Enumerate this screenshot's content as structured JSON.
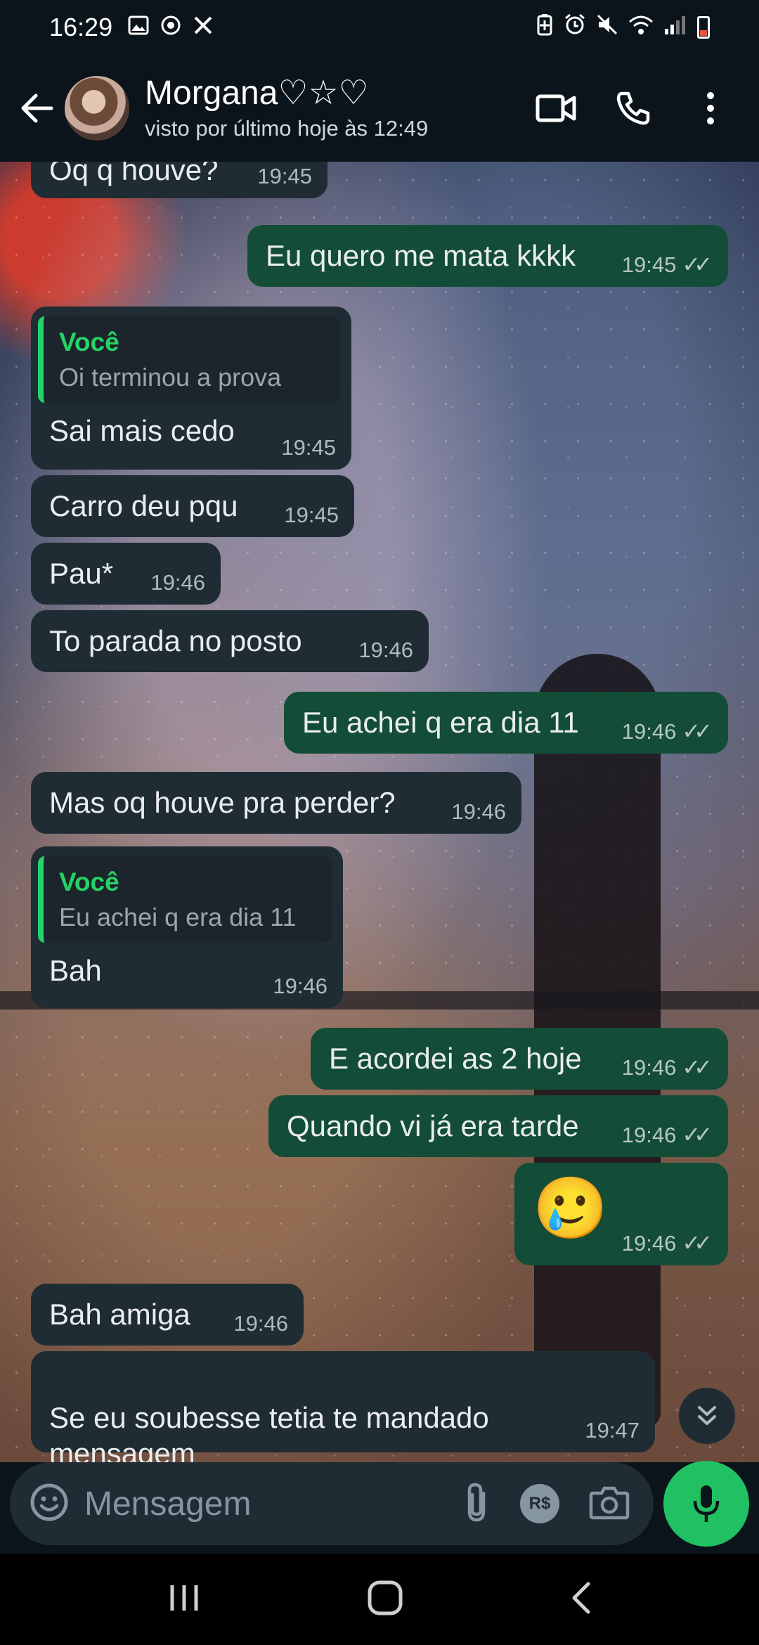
{
  "status_bar": {
    "time": "16:29",
    "left_icons": [
      "gallery-icon",
      "sync-icon",
      "x-icon"
    ],
    "right_icons": [
      "battery-saver-icon",
      "alarm-icon",
      "mute-icon",
      "wifi-icon",
      "signal-icon",
      "battery-icon"
    ]
  },
  "header": {
    "contact_name": "Morgana♡☆♡",
    "last_seen": "visto por último hoje às 12:49"
  },
  "messages": [
    {
      "dir": "in",
      "text": "Oq q houve?",
      "time": "19:45"
    },
    {
      "dir": "out",
      "text": "Eu quero me mata kkkk",
      "time": "19:45"
    },
    {
      "dir": "in",
      "quote_author": "Você",
      "quote_text": "Oi terminou a prova",
      "text": "Sai mais cedo",
      "time": "19:45"
    },
    {
      "dir": "in",
      "text": "Carro deu pqu",
      "time": "19:45"
    },
    {
      "dir": "in",
      "text": "Pau*",
      "time": "19:46"
    },
    {
      "dir": "in",
      "text": "To parada no posto",
      "time": "19:46"
    },
    {
      "dir": "out",
      "text": "Eu achei q era dia 11",
      "time": "19:46"
    },
    {
      "dir": "in",
      "text": "Mas oq houve pra perder?",
      "time": "19:46"
    },
    {
      "dir": "in",
      "quote_author": "Você",
      "quote_text": "Eu achei q era dia 11",
      "text": "Bah",
      "time": "19:46"
    },
    {
      "dir": "out",
      "text": "E acordei as 2 hoje",
      "time": "19:46"
    },
    {
      "dir": "out",
      "text": "Quando vi já era tarde",
      "time": "19:46"
    },
    {
      "dir": "out",
      "text": "🥲",
      "time": "19:46"
    },
    {
      "dir": "in",
      "text": "Bah amiga",
      "time": "19:46"
    },
    {
      "dir": "in",
      "text": "Se eu soubesse tetia te mandado\nmensagem",
      "time": "19:47"
    }
  ],
  "input": {
    "placeholder": "Mensagem",
    "currency_label": "R$"
  },
  "colors": {
    "incoming_bubble": "#202c33",
    "outgoing_bubble": "#144d37",
    "accent_green": "#21c063",
    "quote_author": "#25d366"
  }
}
